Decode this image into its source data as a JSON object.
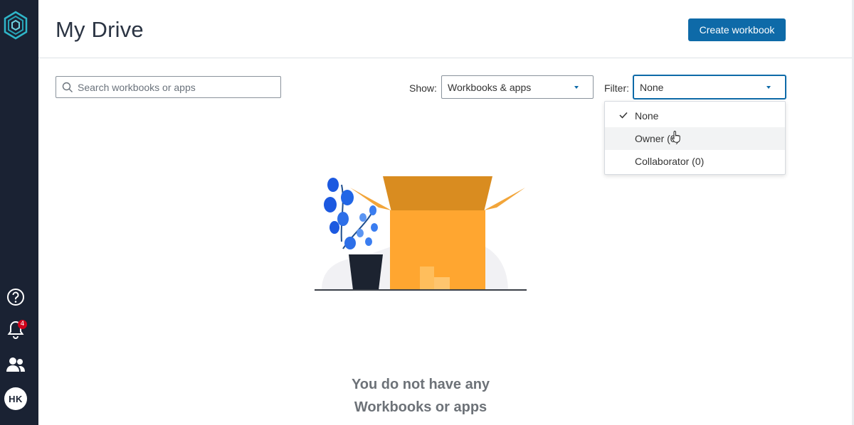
{
  "sidebar": {
    "notification_count": "4",
    "avatar_initials": "HK",
    "icons": [
      "logo-icon",
      "help-icon",
      "bell-icon",
      "users-icon"
    ]
  },
  "header": {
    "title": "My Drive",
    "create_button_label": "Create workbook"
  },
  "toolbar": {
    "search_placeholder": "Search workbooks or apps",
    "show_label": "Show:",
    "show_value": "Workbooks & apps",
    "filter_label": "Filter:",
    "filter_value": "None"
  },
  "filter_menu": {
    "items": [
      {
        "label": "None",
        "checked": true
      },
      {
        "label": "Owner (0)",
        "checked": false
      },
      {
        "label": "Collaborator (0)",
        "checked": false
      }
    ]
  },
  "empty_state": {
    "line1": "You do not have any",
    "line2": "Workbooks or apps"
  },
  "colors": {
    "sidebar_bg": "#1a2233",
    "accent": "#0e6aa8",
    "badge": "#d0021b",
    "box": "#ffa630"
  }
}
